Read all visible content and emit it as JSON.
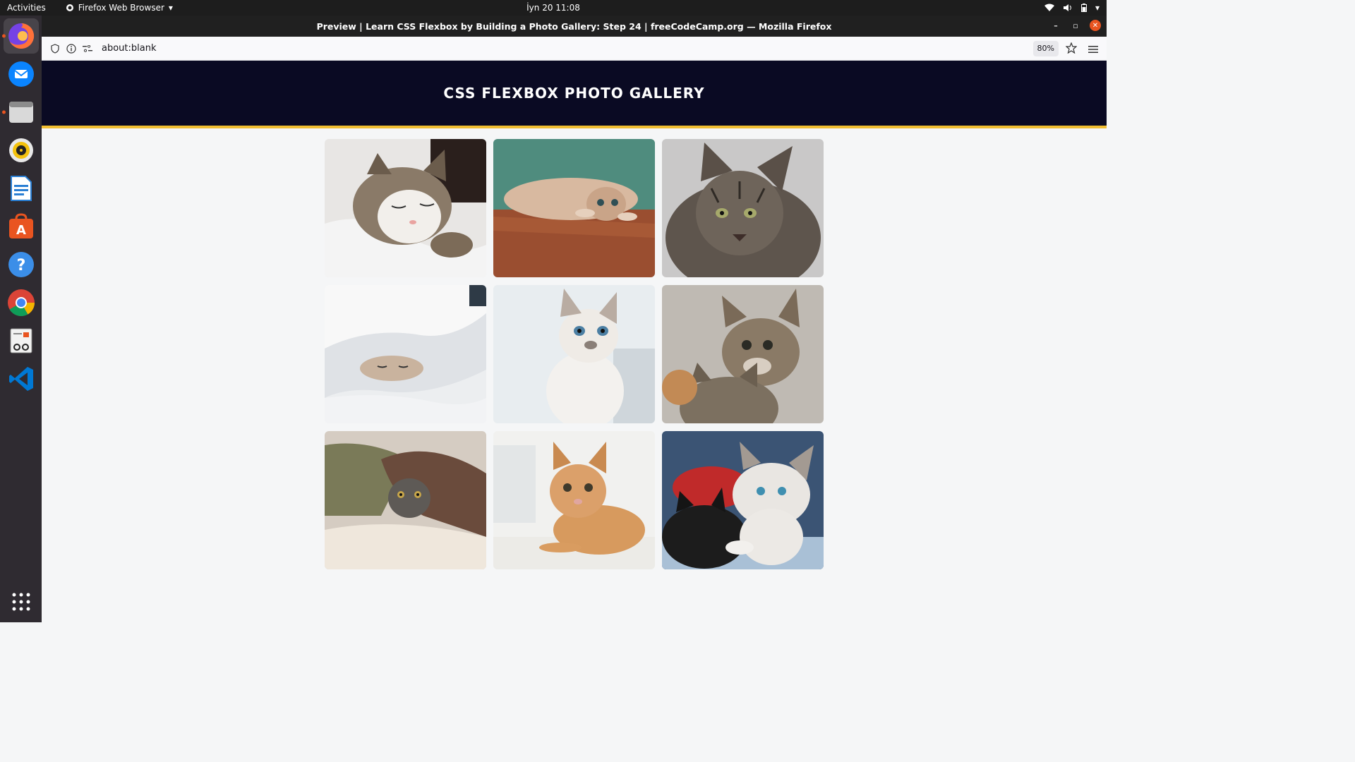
{
  "system": {
    "activities": "Activities",
    "app_menu": "Firefox Web Browser",
    "clock": "İyn 20  11:08"
  },
  "dock": {
    "items": [
      {
        "name": "firefox",
        "color": "#e66000"
      },
      {
        "name": "thunderbird",
        "color": "#0a84ff"
      },
      {
        "name": "files",
        "color": "#b9b9b9"
      },
      {
        "name": "rhythmbox",
        "color": "#f4c20d"
      },
      {
        "name": "writer",
        "color": "#2a7fd4"
      },
      {
        "name": "software",
        "color": "#e95420"
      },
      {
        "name": "help",
        "color": "#3b8ee8"
      },
      {
        "name": "chrome",
        "color": "#34a853"
      },
      {
        "name": "reader",
        "color": "#e2e2e2"
      },
      {
        "name": "vscode",
        "color": "#0078d4"
      }
    ]
  },
  "browser": {
    "title": "Preview | Learn CSS Flexbox by Building a Photo Gallery: Step 24 | freeCodeCamp.org — Mozilla Firefox",
    "url": "about:blank",
    "zoom": "80%"
  },
  "page": {
    "heading": "CSS FLEXBOX PHOTO GALLERY",
    "photos": [
      {
        "subject": "sleeping tabby-white cat"
      },
      {
        "subject": "cat lying on wooden floor"
      },
      {
        "subject": "grey tabby cat"
      },
      {
        "subject": "kitten under white blanket"
      },
      {
        "subject": "white kitten with blue eyes"
      },
      {
        "subject": "two tabby kittens"
      },
      {
        "subject": "cat under brown blanket"
      },
      {
        "subject": "orange kitten"
      },
      {
        "subject": "two kittens, black and white"
      }
    ]
  }
}
